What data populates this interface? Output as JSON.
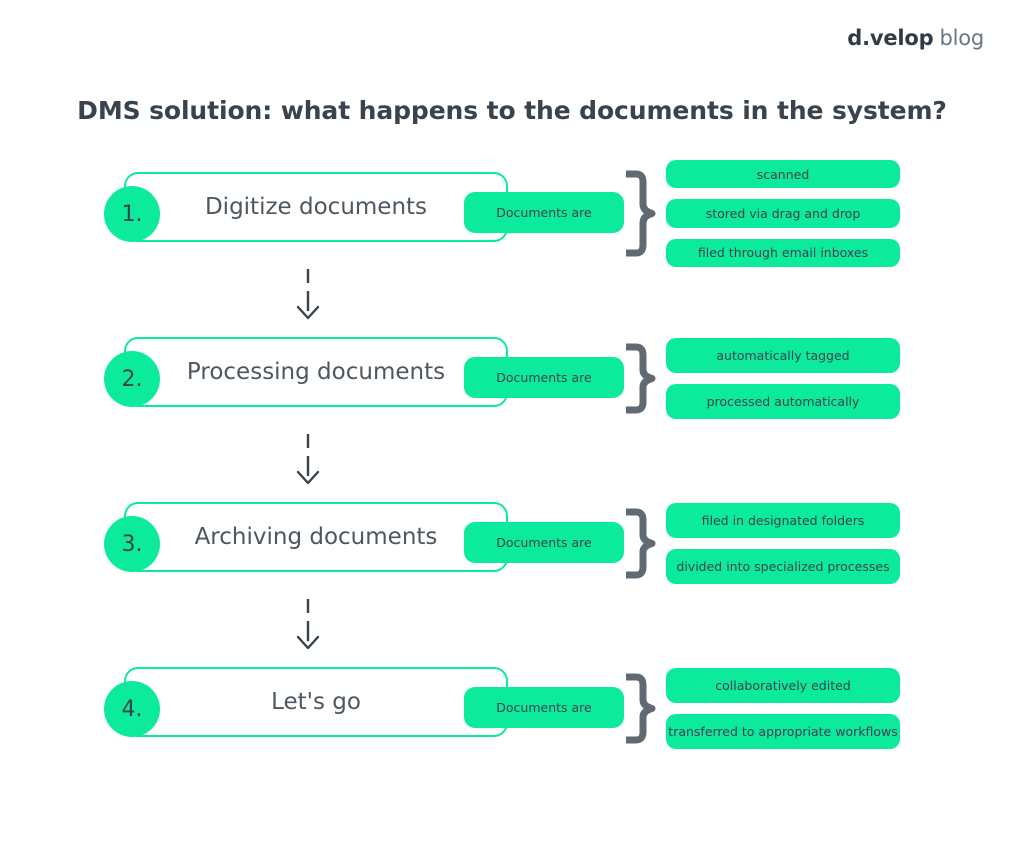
{
  "brand": {
    "mark": "d.velop",
    "word": "blog"
  },
  "title": "DMS solution: what happens to the documents in the system?",
  "colors": {
    "green": "#0ceb9b",
    "slate": "#39434d",
    "brace_gray": "#5f6a75"
  },
  "steps": [
    {
      "number": "1.",
      "title": "Digitize documents",
      "connector_label": "Documents are",
      "outcomes": [
        "scanned",
        "stored via drag and drop",
        "filed through email inboxes"
      ]
    },
    {
      "number": "2.",
      "title": "Processing documents",
      "connector_label": "Documents are",
      "outcomes": [
        "automatically tagged",
        "processed automatically"
      ]
    },
    {
      "number": "3.",
      "title": "Archiving documents",
      "connector_label": "Documents are",
      "outcomes": [
        "filed in designated folders",
        "divided into specialized processes"
      ]
    },
    {
      "number": "4.",
      "title": "Let's go",
      "connector_label": "Documents are",
      "outcomes": [
        "collaboratively edited",
        "transferred to appropriate workflows"
      ]
    }
  ]
}
